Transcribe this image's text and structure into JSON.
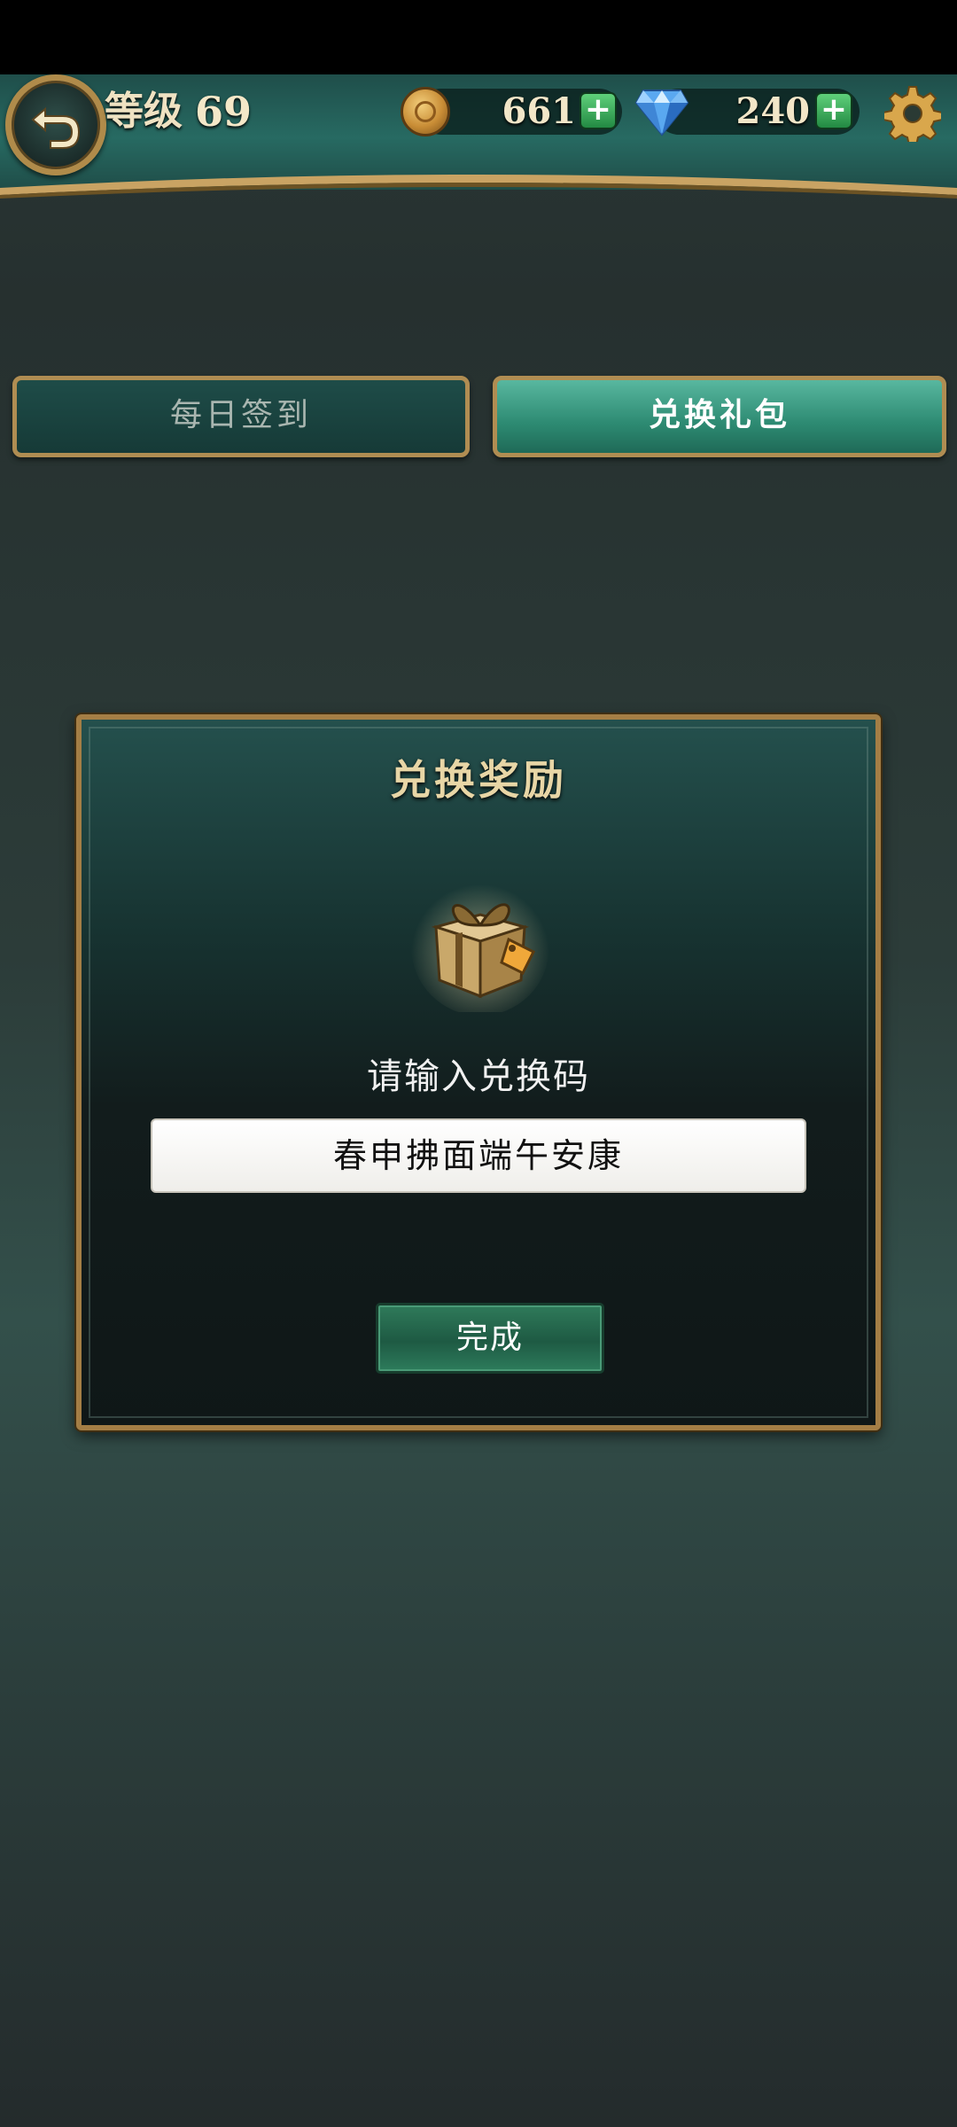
{
  "header": {
    "level_label": "等级",
    "level_value": "69",
    "coins": "661",
    "gems": "240",
    "icons": {
      "back": "back-arrow-icon",
      "coin": "coin-icon",
      "gem": "diamond-icon",
      "settings": "gear-icon",
      "add": "plus-icon"
    }
  },
  "tabs": [
    {
      "label": "每日签到",
      "active": false
    },
    {
      "label": "兑换礼包",
      "active": true
    }
  ],
  "dialog": {
    "title": "兑换奖励",
    "prompt": "请输入兑换码",
    "code_value": "春申拂面端午安康",
    "confirm_label": "完成",
    "icon": "gift-box-icon"
  },
  "colors": {
    "gold": "#b08b4a",
    "teal_active": "#58b79f",
    "plus_green": "#3fb25c"
  }
}
